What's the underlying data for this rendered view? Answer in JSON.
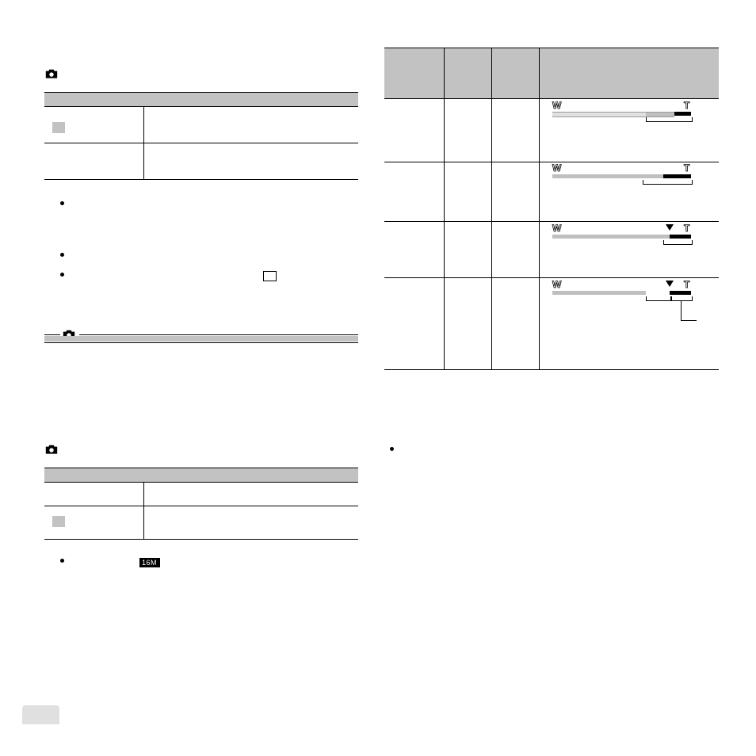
{
  "section_a": {
    "icon": "camera-icon"
  },
  "section_b": {
    "icon": "camera-icon"
  },
  "section_c": {
    "icon": "camera-icon",
    "size_icon_label": "16M"
  },
  "zoom_bars": {
    "row1": {
      "w": "W",
      "t": "T"
    },
    "row2": {
      "w": "W",
      "t": "T"
    },
    "row3": {
      "w": "W",
      "t": "T"
    },
    "row4": {
      "w": "W",
      "t": "T"
    }
  }
}
